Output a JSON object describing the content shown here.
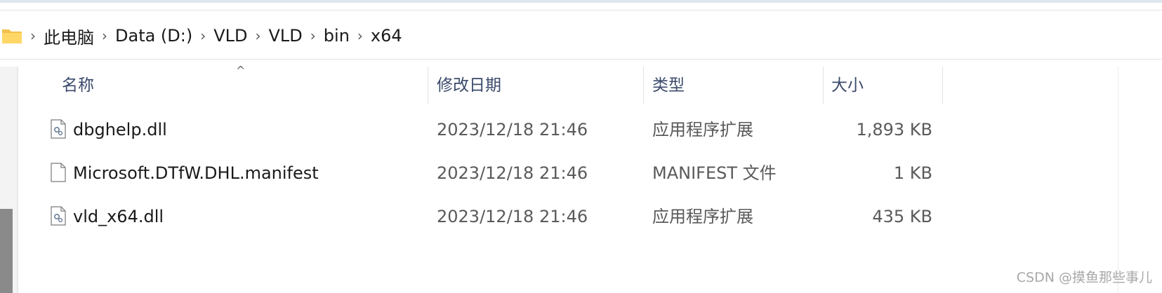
{
  "breadcrumb": {
    "items": [
      "此电脑",
      "Data (D:)",
      "VLD",
      "VLD",
      "bin",
      "x64"
    ]
  },
  "columns": {
    "name": "名称",
    "modified": "修改日期",
    "type": "类型",
    "size": "大小"
  },
  "files": [
    {
      "name": "dbghelp.dll",
      "modified": "2023/12/18 21:46",
      "type": "应用程序扩展",
      "size": "1,893 KB",
      "icon": "dll-file-icon"
    },
    {
      "name": "Microsoft.DTfW.DHL.manifest",
      "modified": "2023/12/18 21:46",
      "type": "MANIFEST 文件",
      "size": "1 KB",
      "icon": "blank-file-icon"
    },
    {
      "name": "vld_x64.dll",
      "modified": "2023/12/18 21:46",
      "type": "应用程序扩展",
      "size": "435 KB",
      "icon": "dll-file-icon"
    }
  ],
  "watermark": "CSDN @摸鱼那些事儿",
  "colors": {
    "folder": "#f2c14e",
    "header_text": "#3b4a6b",
    "secondary_text": "#5a5a5a"
  }
}
